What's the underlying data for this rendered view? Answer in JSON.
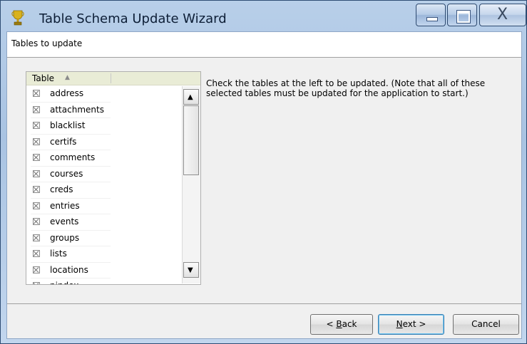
{
  "window": {
    "title": "Table Schema Update Wizard",
    "close_glyph": "X"
  },
  "header": {
    "title": "Tables to update"
  },
  "table": {
    "column_header": "Table",
    "sort_glyph": "▲",
    "rows": [
      {
        "name": "address",
        "checked": false
      },
      {
        "name": "attachments",
        "checked": false
      },
      {
        "name": "blacklist",
        "checked": false
      },
      {
        "name": "certifs",
        "checked": false
      },
      {
        "name": "comments",
        "checked": false
      },
      {
        "name": "courses",
        "checked": false
      },
      {
        "name": "creds",
        "checked": false
      },
      {
        "name": "entries",
        "checked": false
      },
      {
        "name": "events",
        "checked": false
      },
      {
        "name": "groups",
        "checked": false
      },
      {
        "name": "lists",
        "checked": false
      },
      {
        "name": "locations",
        "checked": false
      },
      {
        "name": "pindex",
        "checked": false
      }
    ]
  },
  "instructions": {
    "line1": "Check the tables at the left to be updated. (Note that all of these",
    "line2": "selected tables must be updated for the application to start.)"
  },
  "buttons": {
    "back_prefix": "< ",
    "back_mnemonic": "B",
    "back_rest": "ack",
    "next_mnemonic": "N",
    "next_rest": "ext >",
    "cancel": "Cancel"
  },
  "colors": {
    "titlebar": "#b8cfe9",
    "header_band": "#ffffff",
    "client_bg": "#f0f0f0",
    "column_header": "#e9ecd6"
  },
  "icons": {
    "app": "trophy-icon",
    "minimize": "minimize-icon",
    "maximize": "maximize-icon",
    "close": "close-icon",
    "scroll_up": "chevron-up-icon",
    "scroll_down": "chevron-down-icon"
  }
}
